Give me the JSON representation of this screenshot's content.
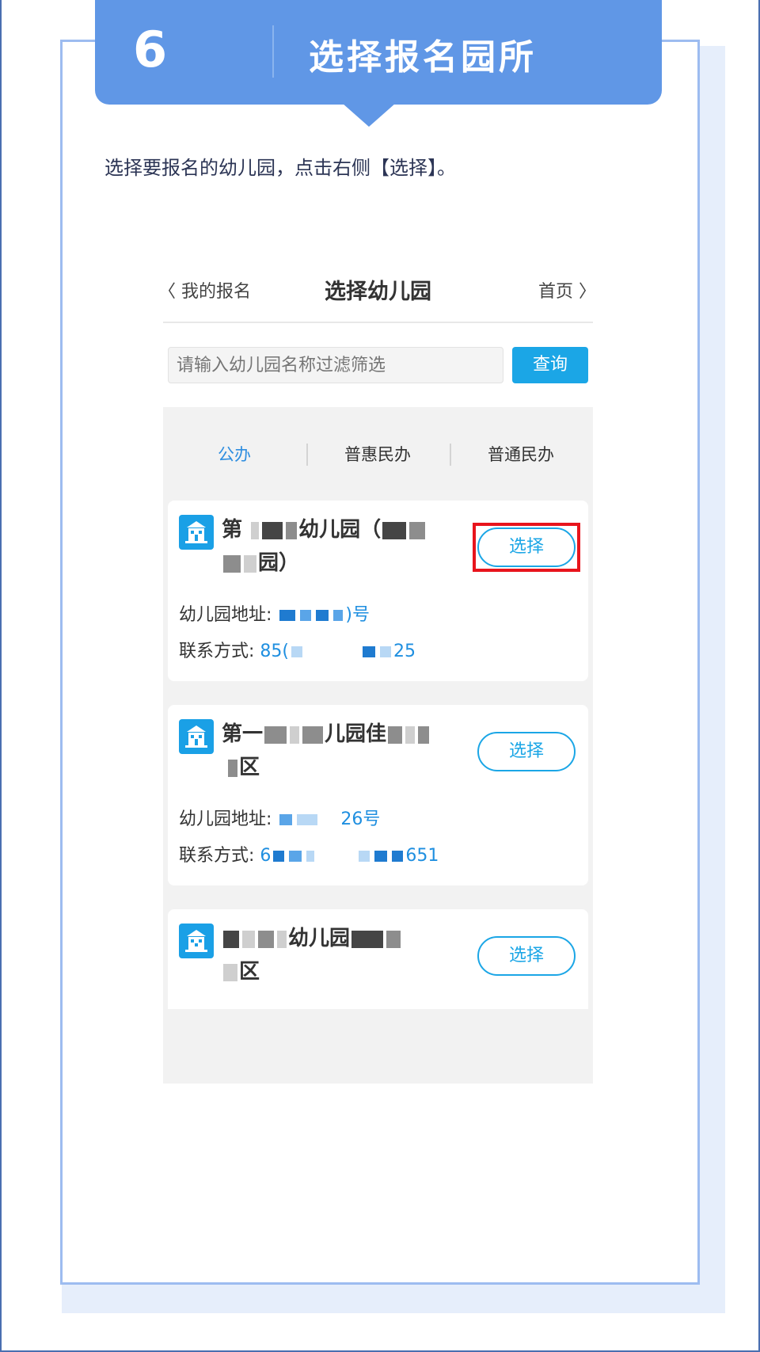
{
  "step": {
    "number": "6",
    "title": "选择报名园所",
    "instruction": "选择要报名的幼儿园，点击右侧【选择】。"
  },
  "colors": {
    "banner": "#6097e6",
    "accent": "#1ba6e6",
    "highlight": "#e8141c",
    "active_tab": "#2f8ee0"
  },
  "phone": {
    "nav": {
      "back_label": "〈 我的报名",
      "title": "选择幼儿园",
      "home_label": "首页 〉"
    },
    "search": {
      "placeholder": "请输入幼儿园名称过滤筛选",
      "button_label": "查询"
    },
    "tabs": [
      {
        "label": "公办",
        "active": true
      },
      {
        "label": "普惠民办",
        "active": false
      },
      {
        "label": "普通民办",
        "active": false
      }
    ],
    "kindergartens": [
      {
        "name_line1_a": "第",
        "name_line1_b": "幼儿园（",
        "name_line2_b": "园）",
        "address_label": "幼儿园地址:",
        "address_tail": ")号",
        "contact_label": "联系方式:",
        "contact_head": "85(",
        "contact_tail": "25",
        "select_label": "选择",
        "highlighted": true
      },
      {
        "name_line1_a": "第一",
        "name_line1_b": "儿园佳",
        "name_line2_b": "区",
        "address_label": "幼儿园地址:",
        "address_tail": "26号",
        "contact_label": "联系方式:",
        "contact_head": "6",
        "contact_tail": "651",
        "select_label": "选择",
        "highlighted": false
      },
      {
        "name_line1_a": "",
        "name_line1_b": "幼儿园",
        "name_line2_b": "区",
        "select_label": "选择",
        "highlighted": false
      }
    ]
  }
}
